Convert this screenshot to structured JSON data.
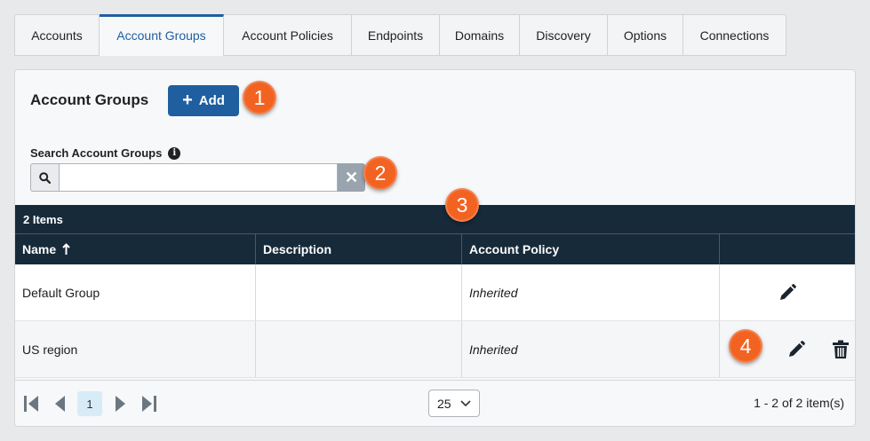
{
  "tabs": [
    "Accounts",
    "Account Groups",
    "Account Policies",
    "Endpoints",
    "Domains",
    "Discovery",
    "Options",
    "Connections"
  ],
  "active_tab": "Account Groups",
  "section": {
    "title": "Account Groups",
    "add_label": "Add"
  },
  "search": {
    "label": "Search Account Groups",
    "value": "",
    "placeholder": ""
  },
  "grid": {
    "count_label": "2 Items",
    "columns": [
      "Name",
      "Description",
      "Account Policy",
      ""
    ],
    "sort_column": "Name",
    "rows": [
      {
        "name": "Default Group",
        "description": "",
        "policy": "Inherited",
        "can_delete": false
      },
      {
        "name": "US region",
        "description": "",
        "policy": "Inherited",
        "can_delete": true
      }
    ]
  },
  "pager": {
    "current_page": "1",
    "page_size": "25",
    "info": "1 - 2 of 2 item(s)"
  },
  "callouts": [
    "1",
    "2",
    "3",
    "4"
  ],
  "colors": {
    "accent": "#1f5fa0",
    "header_bg": "#172a3a",
    "callout": "#f26322"
  }
}
